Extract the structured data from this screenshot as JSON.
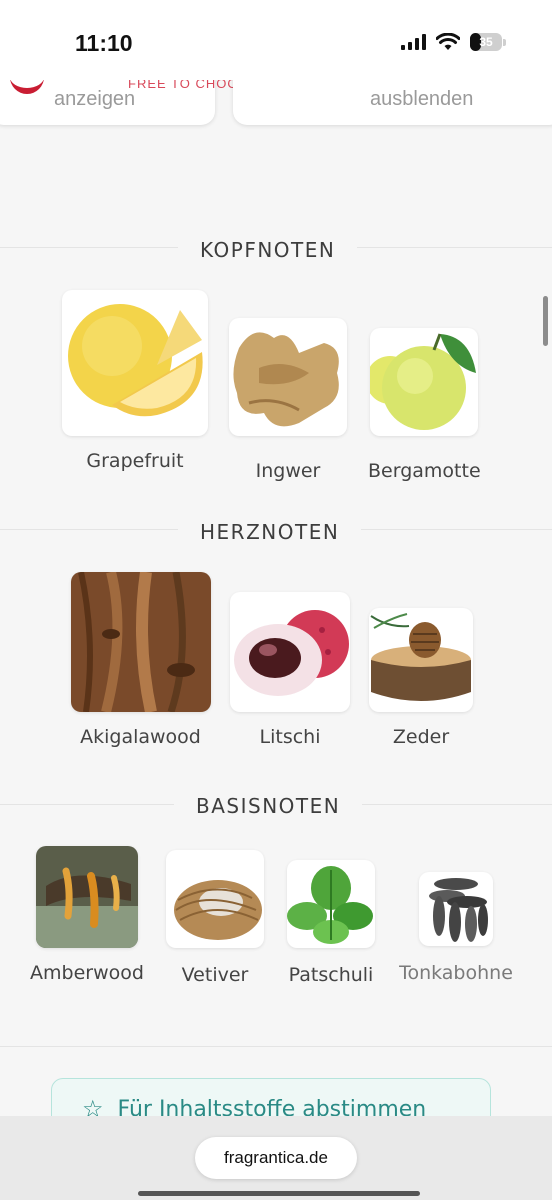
{
  "status": {
    "time": "11:10",
    "battery": "35",
    "battery_level": 0.35
  },
  "filters": {
    "show_label": "anzeigen",
    "hide_label": "ausblenden",
    "tagline": "FREE TO CHOOSE"
  },
  "sections": {
    "top": {
      "title": "KOPFNOTEN",
      "notes": [
        {
          "name": "Grapefruit"
        },
        {
          "name": "Ingwer"
        },
        {
          "name": "Bergamotte"
        }
      ]
    },
    "heart": {
      "title": "HERZNOTEN",
      "notes": [
        {
          "name": "Akigalawood"
        },
        {
          "name": "Litschi"
        },
        {
          "name": "Zeder"
        }
      ]
    },
    "base": {
      "title": "BASISNOTEN",
      "notes": [
        {
          "name": "Amberwood"
        },
        {
          "name": "Vetiver"
        },
        {
          "name": "Patschuli"
        },
        {
          "name": "Tonkabohne"
        }
      ]
    }
  },
  "cta": {
    "label": "Für Inhaltsstoffe abstimmen"
  },
  "browser": {
    "url": "fragrantica.de"
  },
  "icons": [
    "signal-icon",
    "wifi-icon",
    "battery-icon",
    "heart-icon",
    "star-icon"
  ],
  "colors": {
    "accent": "#2a8a85",
    "brand": "#c91d33"
  }
}
